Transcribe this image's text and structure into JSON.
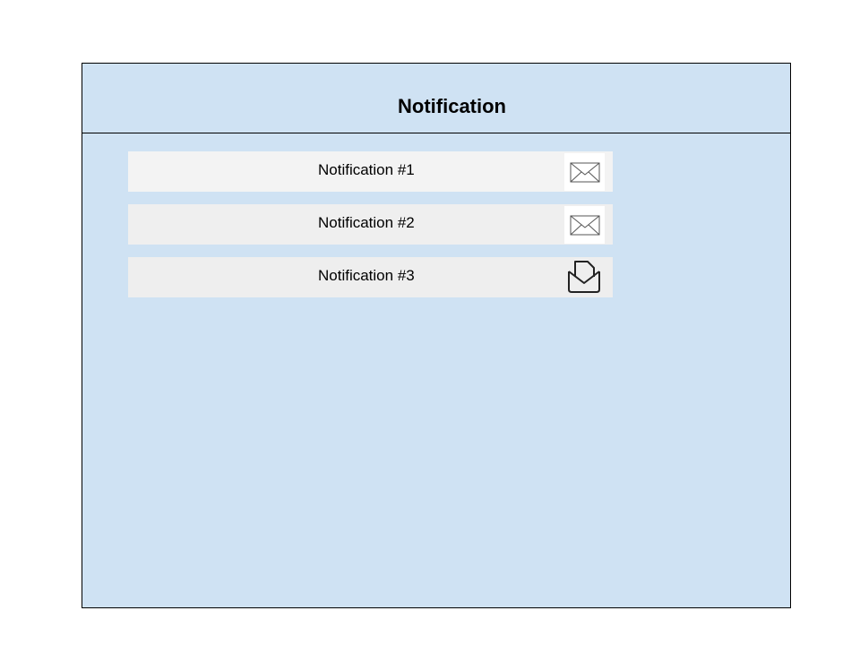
{
  "header": {
    "title": "Notification"
  },
  "notifications": [
    {
      "label": "Notification #1",
      "icon": "envelope-closed-icon",
      "status": "unread"
    },
    {
      "label": "Notification #2",
      "icon": "envelope-closed-icon",
      "status": "unread"
    },
    {
      "label": "Notification #3",
      "icon": "envelope-open-icon",
      "status": "read"
    }
  ],
  "colors": {
    "panel_background": "#cfe2f3",
    "row_background_1": "#f3f3f3",
    "row_background_2": "#efefef",
    "row_background_3": "#eeeeee",
    "border": "#000000"
  }
}
